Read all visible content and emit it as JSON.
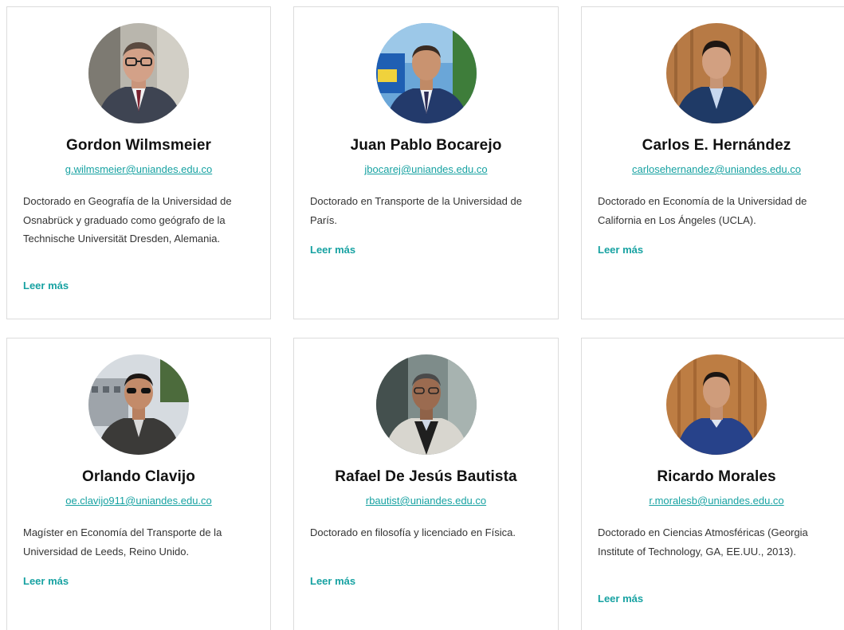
{
  "people": [
    {
      "name": "Gordon Wilmsmeier",
      "email": "g.wilmsmeier@uniandes.edu.co",
      "bio": "Doctorado en Geografía de la Universidad de Osnabrück y graduado como geógrafo de la Technische Universität Dresden, Alemania.",
      "more": "Leer más"
    },
    {
      "name": "Juan Pablo Bocarejo",
      "email": "jbocarej@uniandes.edu.co",
      "bio": "Doctorado en Transporte de la Universidad de París.",
      "more": "Leer más"
    },
    {
      "name": "Carlos E. Hernández",
      "email": "carlosehernandez@uniandes.edu.co",
      "bio": "Doctorado en Economía de la Universidad de California en Los Ángeles (UCLA).",
      "more": "Leer más"
    },
    {
      "name": "Orlando Clavijo",
      "email": "oe.clavijo911@uniandes.edu.co",
      "bio": "Magíster en Economía del Transporte de la Universidad de Leeds, Reino Unido.",
      "more": "Leer más"
    },
    {
      "name": "Rafael De Jesús Bautista",
      "email": "rbautist@uniandes.edu.co",
      "bio": "Doctorado en filosofía y licenciado en Física.",
      "more": "Leer más"
    },
    {
      "name": "Ricardo Morales",
      "email": "r.moralesb@uniandes.edu.co",
      "bio": "Doctorado en Ciencias Atmosféricas (Georgia Institute of Technology, GA, EE.UU., 2013).",
      "more": "Leer más"
    }
  ],
  "colors": {
    "accent": "#17a2a2",
    "border": "#dcdcdc",
    "text": "#333333"
  }
}
